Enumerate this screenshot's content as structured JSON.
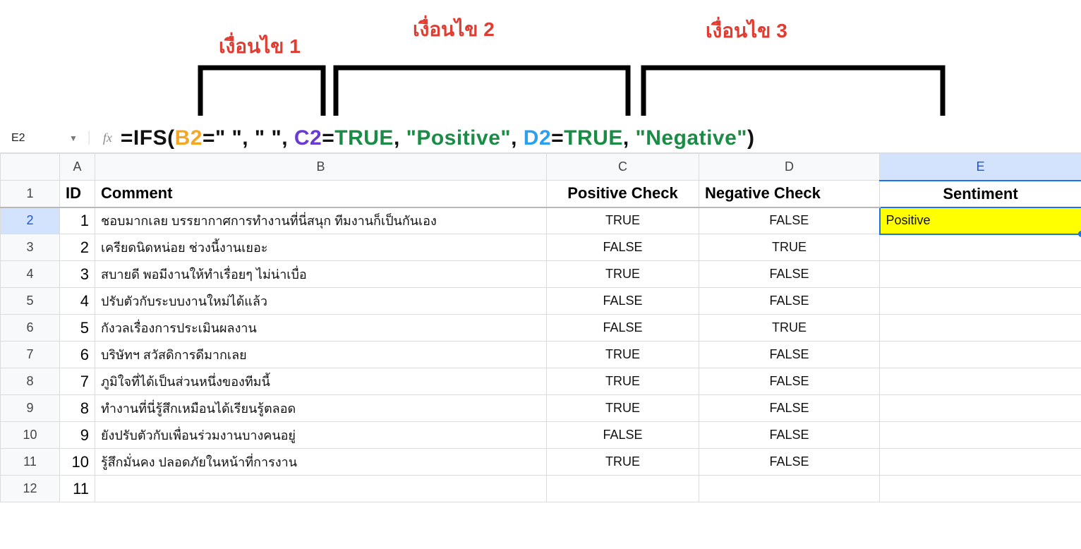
{
  "annotations": {
    "cond1": "เงื่อนไข 1",
    "cond2": "เงื่อนไข 2",
    "cond3": "เงื่อนไข 3"
  },
  "formula_bar": {
    "cell_ref": "E2",
    "fx": "fx",
    "parts": {
      "p1": "=IFS(",
      "b2": "B2",
      "eq1": "=\" \", \" \", ",
      "c2": "C2",
      "eq2": "=",
      "true1": "TRUE",
      "comma1": ", ",
      "pos": "\"Positive\"",
      "comma2": ", ",
      "d2": "D2",
      "eq3": "=",
      "true2": "TRUE",
      "comma3": ", ",
      "neg": "\"Negative\"",
      "close": ")"
    }
  },
  "columns": [
    "",
    "A",
    "B",
    "C",
    "D",
    "E"
  ],
  "headers": {
    "A": "ID",
    "B": "Comment",
    "C": "Positive Check",
    "D": "Negative Check",
    "E": "Sentiment"
  },
  "rows": [
    {
      "n": "2",
      "id": "1",
      "comment": "ชอบมากเลย บรรยากาศการทำงานที่นี่สนุก ทีมงานก็เป็นกันเอง",
      "pos": "TRUE",
      "neg": "FALSE",
      "sent": "Positive"
    },
    {
      "n": "3",
      "id": "2",
      "comment": "เครียดนิดหน่อย ช่วงนี้งานเยอะ",
      "pos": "FALSE",
      "neg": "TRUE",
      "sent": ""
    },
    {
      "n": "4",
      "id": "3",
      "comment": "สบายดี พอมีงานให้ทำเรื่อยๆ ไม่น่าเบื่อ",
      "pos": "TRUE",
      "neg": "FALSE",
      "sent": ""
    },
    {
      "n": "5",
      "id": "4",
      "comment": "ปรับตัวกับระบบงานใหม่ได้แล้ว",
      "pos": "FALSE",
      "neg": "FALSE",
      "sent": ""
    },
    {
      "n": "6",
      "id": "5",
      "comment": "กังวลเรื่องการประเมินผลงาน",
      "pos": "FALSE",
      "neg": "TRUE",
      "sent": ""
    },
    {
      "n": "7",
      "id": "6",
      "comment": "บริษัทฯ สวัสดิการดีมากเลย",
      "pos": "TRUE",
      "neg": "FALSE",
      "sent": ""
    },
    {
      "n": "8",
      "id": "7",
      "comment": "ภูมิใจที่ได้เป็นส่วนหนึ่งของทีมนี้",
      "pos": "TRUE",
      "neg": "FALSE",
      "sent": ""
    },
    {
      "n": "9",
      "id": "8",
      "comment": "ทำงานที่นี่รู้สึกเหมือนได้เรียนรู้ตลอด",
      "pos": "TRUE",
      "neg": "FALSE",
      "sent": ""
    },
    {
      "n": "10",
      "id": "9",
      "comment": "ยังปรับตัวกับเพื่อนร่วมงานบางคนอยู่",
      "pos": "FALSE",
      "neg": "FALSE",
      "sent": ""
    },
    {
      "n": "11",
      "id": "10",
      "comment": "รู้สึกมั่นคง ปลอดภัยในหน้าที่การงาน",
      "pos": "TRUE",
      "neg": "FALSE",
      "sent": ""
    },
    {
      "n": "12",
      "id": "11",
      "comment": "",
      "pos": "",
      "neg": "",
      "sent": ""
    }
  ]
}
